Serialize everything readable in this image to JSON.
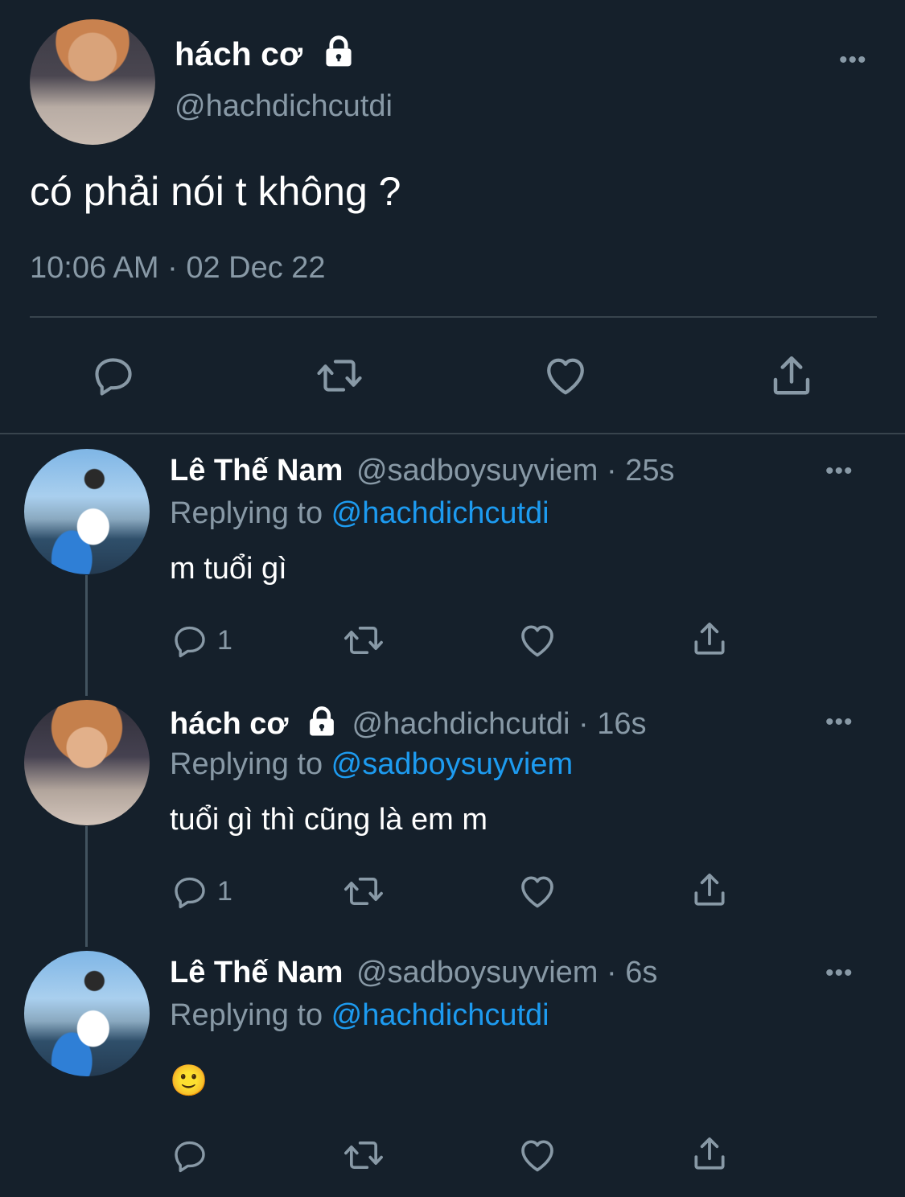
{
  "main_tweet": {
    "name": "hách cơ",
    "handle": "@hachdichcutdi",
    "text": "có phải nói t không ?",
    "timestamp": "10:06 AM · 02 Dec 22",
    "more": "•••"
  },
  "replies": [
    {
      "name": "Lê Thế Nam",
      "handle_time": "@sadboysuyviem · 25s",
      "replying_prefix": "Replying to ",
      "replying_to": "@hachdichcutdi",
      "text": "m tuổi gì",
      "reply_count": "1",
      "more": "•••"
    },
    {
      "name": "hách cơ",
      "handle_time": "@hachdichcutdi · 16s",
      "replying_prefix": "Replying to ",
      "replying_to": "@sadboysuyviem",
      "text": "tuổi gì thì cũng là em m",
      "reply_count": "1",
      "more": "•••"
    },
    {
      "name": "Lê Thế Nam",
      "handle_time": "@sadboysuyviem · 6s",
      "replying_prefix": "Replying to ",
      "replying_to": "@hachdichcutdi",
      "text": "🙂",
      "reply_count": "",
      "more": "•••"
    }
  ],
  "icons": {
    "reply": "reply-icon",
    "retweet": "retweet-icon",
    "like": "heart-icon",
    "share": "share-icon",
    "lock": "lock-icon",
    "more": "more-icon"
  },
  "colors": {
    "background": "#15202b",
    "muted": "#8899a6",
    "link": "#1d9bf0",
    "divider": "#38444d"
  }
}
